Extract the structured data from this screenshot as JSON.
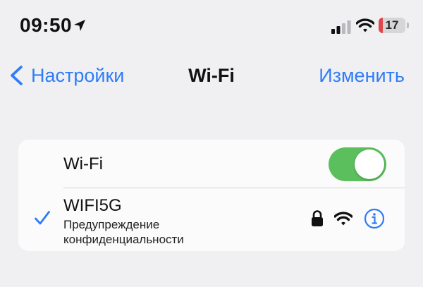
{
  "status_bar": {
    "time": "09:50",
    "battery_level": "17",
    "icons": [
      "location-arrow-icon",
      "cellular-signal-icon",
      "wifi-icon",
      "battery-icon"
    ],
    "battery_color": "#e0464a"
  },
  "nav": {
    "back_label": "Настройки",
    "title": "Wi-Fi",
    "edit_label": "Изменить"
  },
  "wifi_row": {
    "label": "Wi-Fi",
    "toggle_on": true
  },
  "network": {
    "name": "WIFI5G",
    "warning": "Предупреждение конфиденциальности",
    "connected": true,
    "secured": true
  },
  "colors": {
    "accent": "#2f7cf6",
    "toggle_on": "#5cbf5e",
    "background": "#f0f0f3",
    "card": "#fbfbfc"
  }
}
